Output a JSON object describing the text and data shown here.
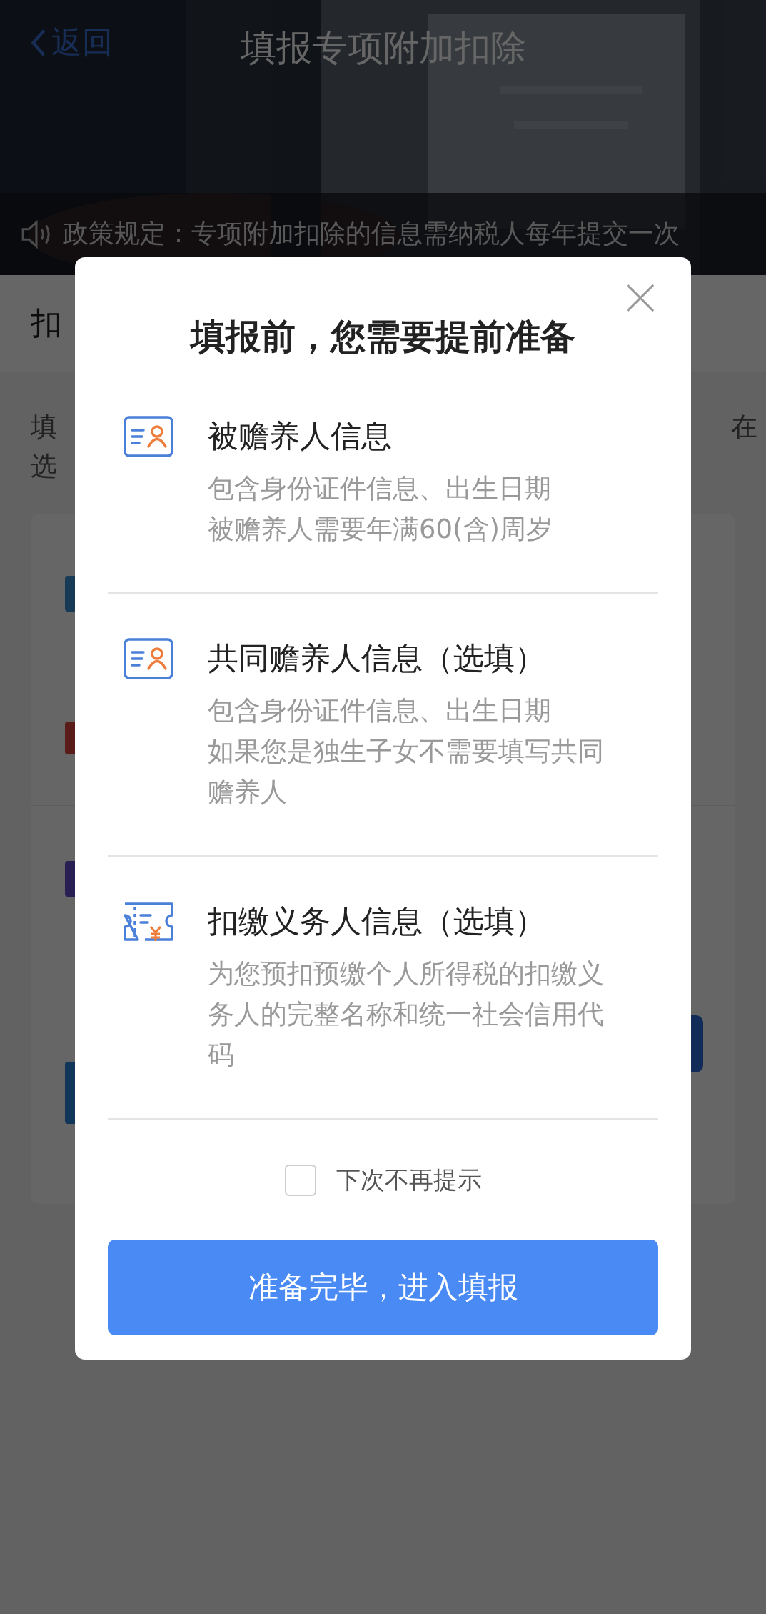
{
  "nav": {
    "back": "返回",
    "title": "填报专项附加扣除"
  },
  "notice": {
    "text": "政策规定：专项附加扣除的信息需纳税人每年提交一次"
  },
  "section": {
    "title_fragment": "扣"
  },
  "intro": {
    "left_fragments": [
      "填",
      "选"
    ],
    "right_fragment": "在"
  },
  "modal": {
    "title": "填报前，您需要提前准备",
    "items": [
      {
        "kind": "id-card",
        "title": "被赡养人信息",
        "lines": [
          "包含身份证件信息、出生日期",
          "被赡养人需要年满60(含)周岁"
        ]
      },
      {
        "kind": "id-card",
        "title": "共同赡养人信息（选填）",
        "lines": [
          "包含身份证件信息、出生日期",
          "如果您是独生子女不需要填写共同赡养人"
        ]
      },
      {
        "kind": "ticket",
        "title": "扣缴义务人信息（选填）",
        "lines": [
          "为您预扣预缴个人所得税的扣缴义务人的完整名称和统一社会信用代码"
        ]
      }
    ],
    "dont_show": {
      "label": "下次不再提示",
      "checked": false
    },
    "confirm": "准备完毕，进入填报"
  }
}
